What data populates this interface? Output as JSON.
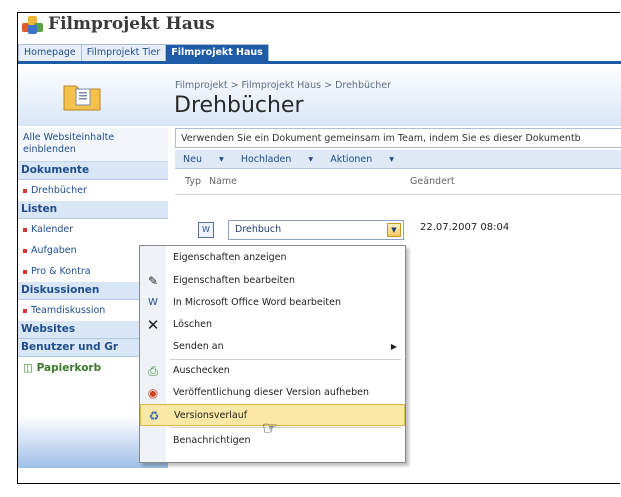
{
  "site": {
    "title": "Filmprojekt Haus"
  },
  "tabs": [
    {
      "label": "Homepage"
    },
    {
      "label": "Filmprojekt Tier"
    },
    {
      "label": "Filmprojekt Haus"
    }
  ],
  "breadcrumb": "Filmprojekt > Filmprojekt Haus > Drehbücher",
  "page_title": "Drehbücher",
  "description": "Verwenden Sie ein Dokument gemeinsam im Team, indem Sie es dieser Dokumentb",
  "toolbar": {
    "new": "Neu",
    "upload": "Hochladen",
    "actions": "Aktionen"
  },
  "columns": {
    "type": "Typ",
    "name": "Name",
    "modified": "Geändert"
  },
  "document": {
    "name": "Drehbuch",
    "modified": "22.07.2007 08:04"
  },
  "nav": {
    "all_content": "Alle Websiteinhalte einblenden",
    "documents_head": "Dokumente",
    "documents_items": [
      "Drehbücher"
    ],
    "lists_head": "Listen",
    "lists_items": [
      "Kalender",
      "Aufgaben",
      "Pro & Kontra"
    ],
    "discussions_head": "Diskussionen",
    "discussions_items": [
      "Teamdiskussion"
    ],
    "websites_head": "Websites",
    "people_head": "Benutzer und Gr",
    "recycle": "Papierkorb"
  },
  "menu": {
    "items": [
      {
        "label": "Eigenschaften anzeigen",
        "icon": "none"
      },
      {
        "label": "Eigenschaften bearbeiten",
        "icon": "edit-icon"
      },
      {
        "label": "In Microsoft Office Word bearbeiten",
        "icon": "word-icon"
      },
      {
        "label": "Löschen",
        "icon": "delete-icon"
      },
      {
        "label": "Senden an",
        "icon": "none"
      },
      {
        "label": "Auschecken",
        "icon": "checkout-icon"
      },
      {
        "label": "Veröffentlichung dieser Version aufheben",
        "icon": "unpublish-icon"
      },
      {
        "label": "Versionsverlauf",
        "icon": "version-history-icon"
      },
      {
        "label": "Benachrichtigen",
        "icon": "none"
      }
    ]
  },
  "colors": {
    "accent": "#1f5ca8",
    "highlight": "#fbe8a6"
  }
}
